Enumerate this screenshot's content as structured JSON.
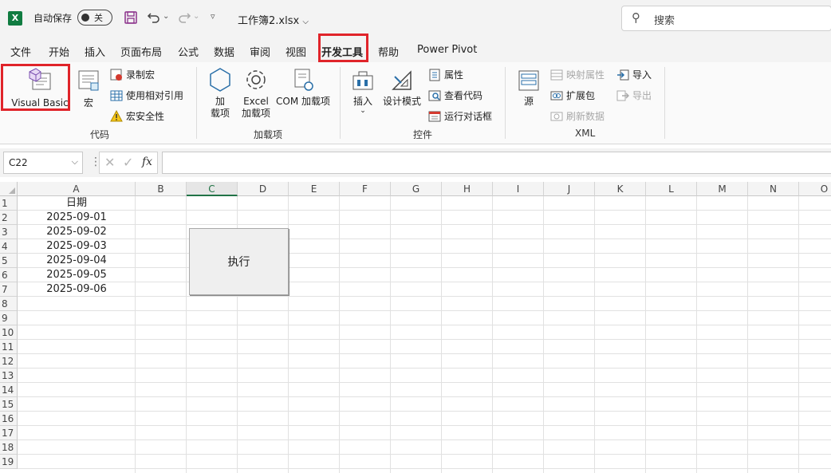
{
  "titlebar": {
    "app_logo": "X",
    "autosave_label": "自动保存",
    "autosave_state": "关",
    "filename": "工作簿2.xlsx",
    "search_placeholder": "搜索"
  },
  "menu": {
    "items": [
      "文件",
      "开始",
      "插入",
      "页面布局",
      "公式",
      "数据",
      "审阅",
      "视图",
      "开发工具",
      "帮助",
      "Power Pivot"
    ],
    "active": "开发工具"
  },
  "ribbon": {
    "code": {
      "label": "代码",
      "visual_basic": "Visual Basic",
      "macros": "宏",
      "record_macro": "录制宏",
      "use_relative": "使用相对引用",
      "macro_security": "宏安全性"
    },
    "addins": {
      "label": "加载项",
      "addins_line1": "加",
      "addins_line2": "载项",
      "excel_line1": "Excel",
      "excel_line2": "加载项",
      "com_addins": "COM 加载项"
    },
    "controls": {
      "label": "控件",
      "insert": "插入",
      "design_mode": "设计模式",
      "properties": "属性",
      "view_code": "查看代码",
      "run_dialog": "运行对话框"
    },
    "xml": {
      "label": "XML",
      "source": "源",
      "map_properties": "映射属性",
      "expansion_packs": "扩展包",
      "refresh_data": "刷新数据",
      "import": "导入",
      "export": "导出"
    }
  },
  "formula_bar": {
    "name_box": "C22",
    "fx": "fx",
    "value": ""
  },
  "sheet": {
    "columns": [
      "A",
      "B",
      "C",
      "D",
      "E",
      "F",
      "G",
      "H",
      "I",
      "J",
      "K",
      "L",
      "M",
      "N",
      "O"
    ],
    "selected_column": "C",
    "rows": [
      "1",
      "2",
      "3",
      "4",
      "5",
      "6",
      "7",
      "8",
      "9",
      "10",
      "11",
      "12",
      "13",
      "14",
      "15",
      "16",
      "17",
      "18",
      "19"
    ],
    "cells_a": [
      "日期",
      "2025-09-01",
      "2025-09-02",
      "2025-09-03",
      "2025-09-04",
      "2025-09-05",
      "2025-09-06"
    ],
    "button_label": "执行"
  },
  "colors": {
    "excel_green": "#107c41",
    "highlight_red": "#e0242a",
    "selected_header": "#217346"
  }
}
